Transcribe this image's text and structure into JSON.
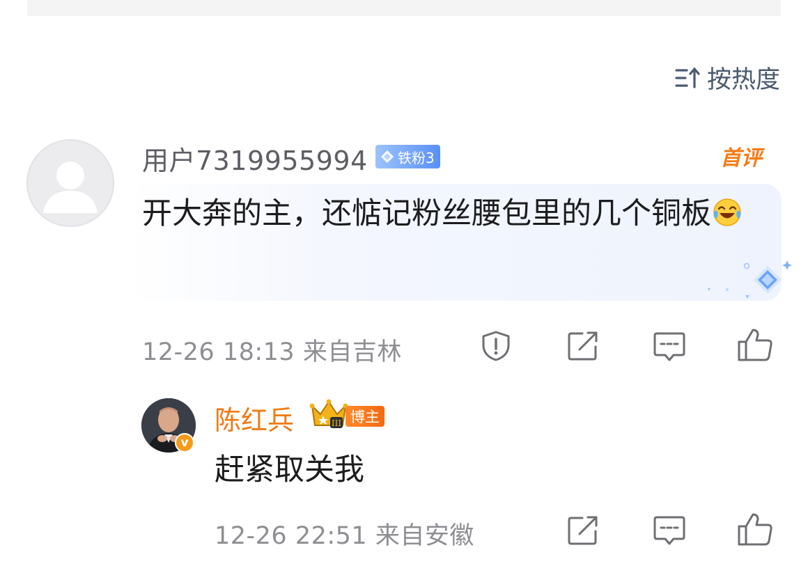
{
  "sort": {
    "label": "按热度",
    "icon": "sort-icon"
  },
  "comment": {
    "username": "用户7319955994",
    "fan_badge": "铁粉3",
    "first_badge": "首评",
    "text": "开大奔的主，还惦记粉丝腰包里的几个铜板",
    "emoji": "laughing-crying-emoji",
    "timestamp": "12-26 18:13",
    "location": "来自吉林",
    "actions": [
      "report-icon",
      "share-icon",
      "reply-icon",
      "like-icon"
    ]
  },
  "reply": {
    "username": "陈红兵",
    "role_badge": "博主",
    "verified_mark": "v",
    "text": "赶紧取关我",
    "timestamp": "12-26 22:51",
    "location": "来自安徽",
    "actions": [
      "share-icon",
      "reply-icon",
      "like-icon"
    ]
  },
  "colors": {
    "accent_orange": "#f07a13",
    "fan_badge_blue": "#5a8ff5",
    "meta_gray": "#8e8e93",
    "icon_gray": "#6e6e73"
  }
}
